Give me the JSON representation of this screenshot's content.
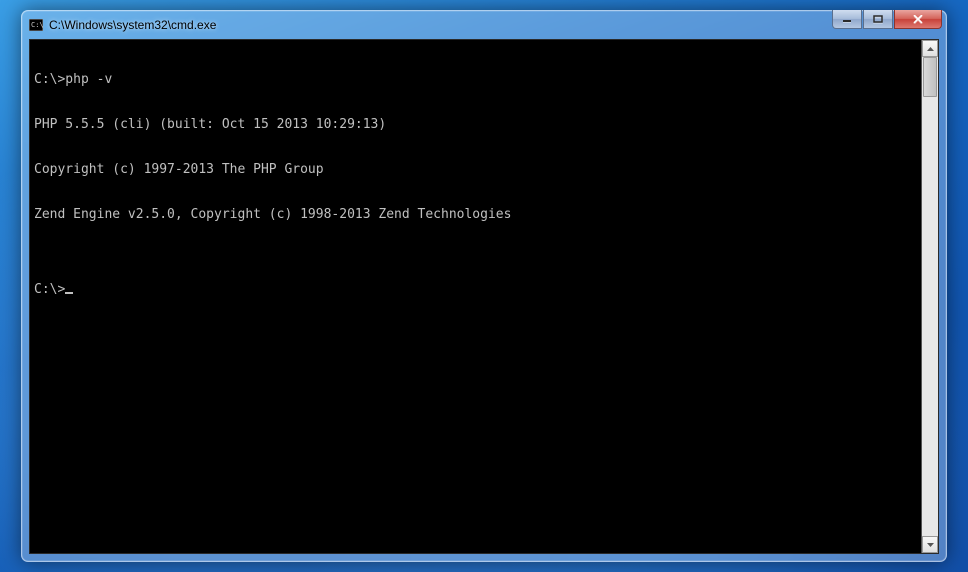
{
  "window": {
    "title": "C:\\Windows\\system32\\cmd.exe"
  },
  "terminal": {
    "lines": [
      "C:\\>php -v",
      "PHP 5.5.5 (cli) (built: Oct 15 2013 10:29:13)",
      "Copyright (c) 1997-2013 The PHP Group",
      "Zend Engine v2.5.0, Copyright (c) 1998-2013 Zend Technologies",
      "",
      "C:\\>"
    ]
  }
}
